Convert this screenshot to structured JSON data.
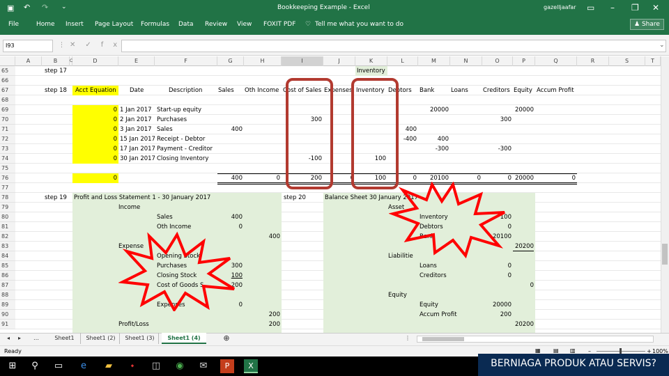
{
  "window": {
    "title": "Bookkeeping Example - Excel",
    "user": "gazelljaafar",
    "share": "Share",
    "tell_me": "Tell me what you want to do"
  },
  "menu": [
    "File",
    "Home",
    "Insert",
    "Page Layout",
    "Formulas",
    "Data",
    "Review",
    "View",
    "FOXIT PDF"
  ],
  "name_box": "I93",
  "columns": [
    "A",
    "B",
    "C",
    "D",
    "E",
    "F",
    "G",
    "H",
    "I",
    "J",
    "K",
    "L",
    "M",
    "N",
    "O",
    "P",
    "Q",
    "R",
    "S",
    "T"
  ],
  "rows": [
    "65",
    "66",
    "67",
    "68",
    "69",
    "70",
    "71",
    "72",
    "73",
    "74",
    "75",
    "76",
    "77",
    "78",
    "79",
    "80",
    "81",
    "82",
    "83",
    "84",
    "85",
    "86",
    "87",
    "88",
    "89",
    "90",
    "91"
  ],
  "sheet": {
    "step17": "step 17",
    "inventory_title": "Inventory",
    "step18": "step 18",
    "headers": {
      "acct_equation": "Acct Equation",
      "date": "Date",
      "description": "Description",
      "sales": "Sales",
      "oth_income": "Oth Income",
      "cost_of_sales": "Cost of Sales",
      "expenses": "Expenses",
      "inventory": "Inventory",
      "debtors": "Debtors",
      "bank": "Bank",
      "loans": "Loans",
      "creditors": "Creditors",
      "equity": "Equity",
      "accum_profit": "Accum Profit"
    },
    "transactions": [
      {
        "eq": "0",
        "date": "1 Jan 2017",
        "desc": "Start-up equity",
        "sales": "",
        "cos": "",
        "inv": "",
        "debtors": "",
        "bank": "20000",
        "creditors": "",
        "equity": "20000"
      },
      {
        "eq": "0",
        "date": "2 Jan 2017",
        "desc": "Purchases",
        "sales": "",
        "cos": "300",
        "inv": "",
        "debtors": "",
        "bank": "",
        "creditors": "300",
        "equity": ""
      },
      {
        "eq": "0",
        "date": "3 Jan 2017",
        "desc": "Sales",
        "sales": "400",
        "cos": "",
        "inv": "",
        "debtors": "400",
        "bank": "",
        "creditors": "",
        "equity": ""
      },
      {
        "eq": "0",
        "date": "15 Jan 2017",
        "desc": "Receipt - Debtor",
        "sales": "",
        "cos": "",
        "inv": "",
        "debtors": "-400",
        "bank": "400",
        "creditors": "",
        "equity": ""
      },
      {
        "eq": "0",
        "date": "17 Jan 2017",
        "desc": "Payment - Creditor",
        "sales": "",
        "cos": "",
        "inv": "",
        "debtors": "",
        "bank": "-300",
        "creditors": "-300",
        "equity": ""
      },
      {
        "eq": "0",
        "date": "30 Jan 2017",
        "desc": "Closing Inventory",
        "sales": "",
        "cos": "-100",
        "inv": "100",
        "debtors": "",
        "bank": "",
        "creditors": "",
        "equity": ""
      }
    ],
    "totals": {
      "eq": "0",
      "sales": "400",
      "oth": "0",
      "cos": "200",
      "exp": "0",
      "inv": "100",
      "debtors": "0",
      "bank": "20100",
      "loans": "0",
      "creditors": "0",
      "equity": "20000",
      "accum": "0"
    },
    "step19": "step 19",
    "pl_title": "Profit and Loss Statement 1 - 30 January 2017",
    "pl": {
      "income": "Income",
      "sales": "Sales",
      "sales_v": "400",
      "oth": "Oth Income",
      "oth_v": "0",
      "income_total": "400",
      "expenses": "Expense",
      "opening": "Opening Stock",
      "purchases": "Purchases",
      "purchases_v": "300",
      "closing": "Closing Stock",
      "closing_v": "100",
      "cogs": "Cost of Goods S",
      "cogs_v": "200",
      "exp": "Expenses",
      "exp_v": "0",
      "exp_total": "200",
      "profit": "Profit/Loss",
      "profit_v": "200"
    },
    "step20": "step 20",
    "bs_title": "Balance Sheet 30 January 2017",
    "bs": {
      "asset": "Asset",
      "inventory": "Inventory",
      "inventory_v": "100",
      "debtors": "Debtors",
      "debtors_v": "0",
      "bank": "Bank",
      "bank_v": "20100",
      "asset_total": "20200",
      "liabilities": "Liabilitie",
      "loans": "Loans",
      "loans_v": "0",
      "creditors": "Creditors",
      "creditors_v": "0",
      "liab_total": "0",
      "equity": "Equity",
      "equity_l": "Equity",
      "equity_v": "20000",
      "accum": "Accum Profit",
      "accum_v": "200",
      "equity_total": "20200"
    }
  },
  "sheet_tabs": [
    "Sheet1",
    "Sheet1 (2)",
    "Sheet1 (3)",
    "Sheet1 (4)"
  ],
  "active_tab": "Sheet1 (4)",
  "status": {
    "ready": "Ready",
    "zoom": "100%"
  },
  "banner": "BERNIAGA PRODUK ATAU SERVIS?",
  "colors": {
    "excel_green": "#217346",
    "yellow": "#ffff00",
    "light_green": "#e2efda",
    "highlight_red": "#b23a30",
    "star_red": "#ff0000"
  }
}
